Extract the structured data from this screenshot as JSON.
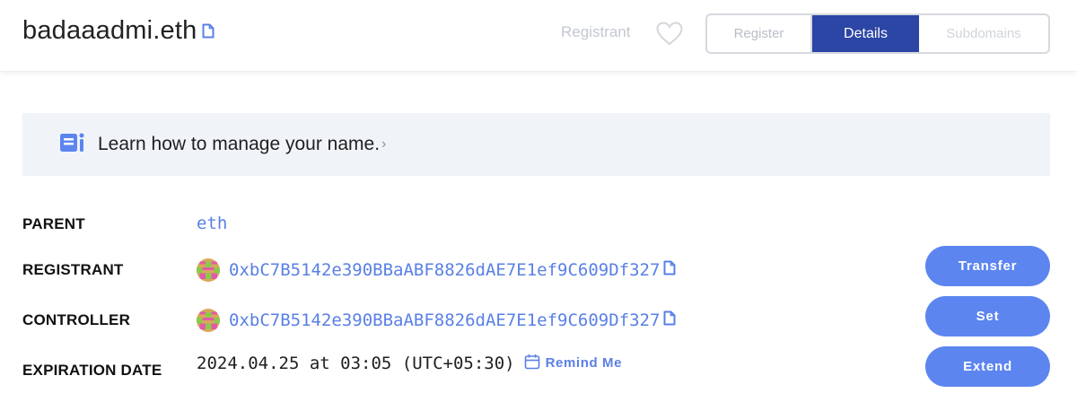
{
  "header": {
    "domain": "badaaadmi.eth",
    "registrant_link": "Registrant",
    "tabs": [
      {
        "label": "Register"
      },
      {
        "label": "Details"
      },
      {
        "label": "Subdomains"
      }
    ],
    "active_tab": "Details"
  },
  "banner": {
    "text": "Learn how to manage your name.",
    "chevron": "›"
  },
  "details": {
    "parent": {
      "label": "PARENT",
      "value": "eth"
    },
    "registrant": {
      "label": "REGISTRANT",
      "address": "0xbC7B5142e390BBaABF8826dAE7E1ef9C609Df327",
      "button": "Transfer"
    },
    "controller": {
      "label": "CONTROLLER",
      "address": "0xbC7B5142e390BBaABF8826dAE7E1ef9C609Df327",
      "button": "Set"
    },
    "expiration": {
      "label": "EXPIRATION DATE",
      "value": "2024.04.25 at 03:05 (UTC+05:30)",
      "remind": "Remind Me",
      "button": "Extend"
    }
  },
  "colors": {
    "accent": "#5c85f0",
    "active_tab": "#2c46a6",
    "link": "#5a80e6",
    "banner_bg": "#f0f4f9"
  },
  "icons": [
    "copy-icon",
    "heart-icon",
    "book-icon",
    "calendar-icon",
    "avatar-identicon"
  ]
}
